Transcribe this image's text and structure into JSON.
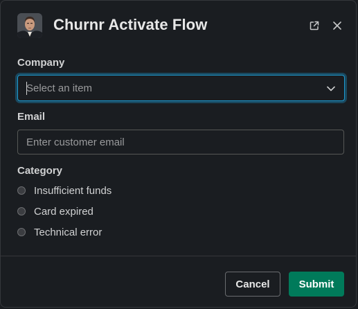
{
  "modal": {
    "title": "Churnr Activate Flow",
    "popout_icon": "external-link-icon",
    "close_icon": "close-icon"
  },
  "form": {
    "company": {
      "label": "Company",
      "placeholder": "Select an item",
      "dropdown_icon": "chevron-down-icon"
    },
    "email": {
      "label": "Email",
      "placeholder": "Enter customer email",
      "value": ""
    },
    "category": {
      "label": "Category",
      "options": [
        {
          "label": "Insufficient funds",
          "selected": false
        },
        {
          "label": "Card expired",
          "selected": false
        },
        {
          "label": "Technical error",
          "selected": false
        }
      ]
    }
  },
  "footer": {
    "cancel_label": "Cancel",
    "submit_label": "Submit"
  },
  "colors": {
    "background": "#1a1d21",
    "focus_ring": "#1d9bd1",
    "submit": "#007a5a"
  }
}
